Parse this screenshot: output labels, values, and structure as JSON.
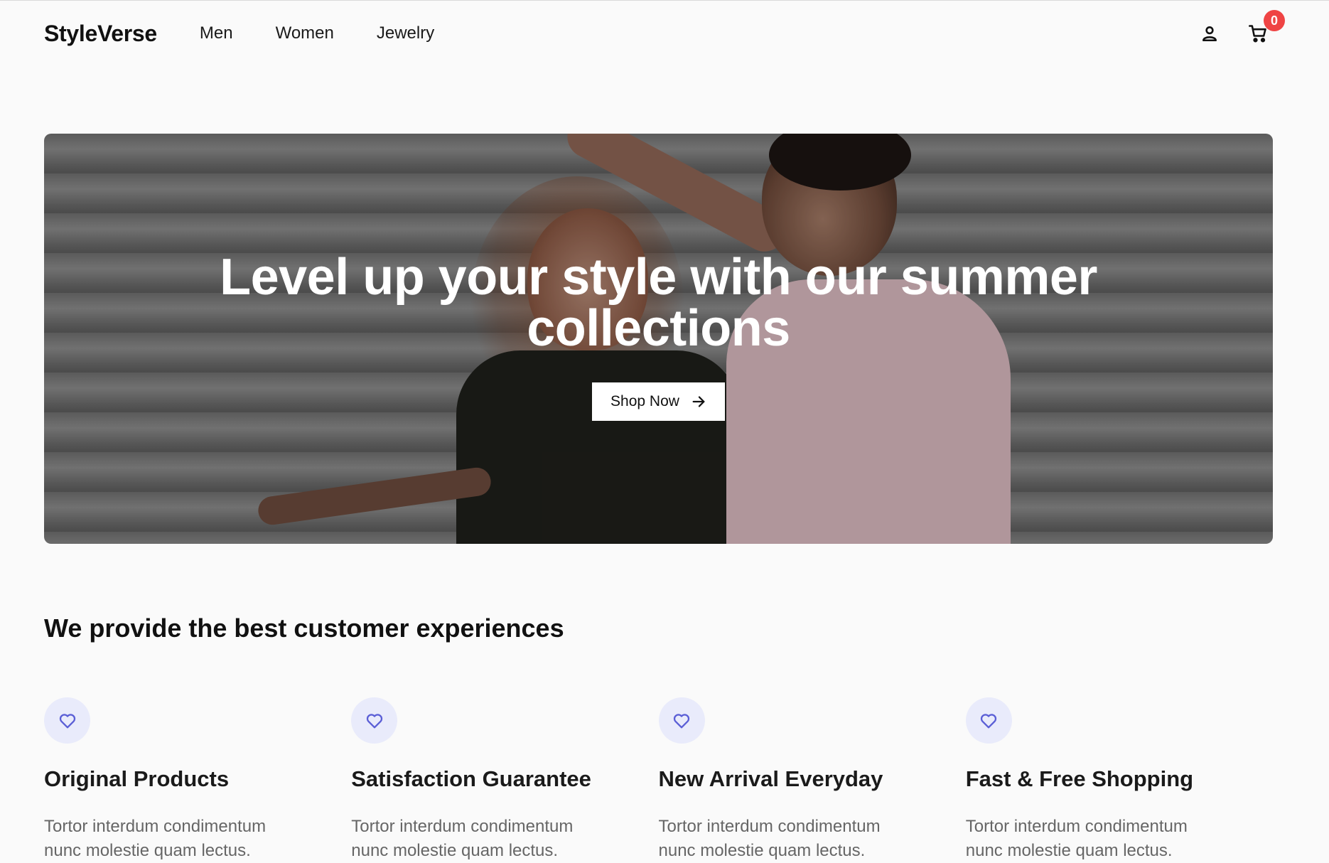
{
  "header": {
    "logo": "StyleVerse",
    "nav": [
      {
        "label": "Men"
      },
      {
        "label": "Women"
      },
      {
        "label": "Jewelry"
      }
    ],
    "cart_count": "0",
    "icons": [
      "user-icon",
      "cart-icon"
    ]
  },
  "hero": {
    "title": "Level up your style with our summer collections",
    "cta_label": "Shop Now",
    "cta_icon": "arrow-right-icon"
  },
  "features_section": {
    "title": "We provide the best customer experiences",
    "items": [
      {
        "icon": "heart-icon",
        "title": "Original Products",
        "desc": "Tortor interdum condimentum nunc molestie quam lectus."
      },
      {
        "icon": "heart-icon",
        "title": "Satisfaction Guarantee",
        "desc": "Tortor interdum condimentum nunc molestie quam lectus."
      },
      {
        "icon": "heart-icon",
        "title": "New Arrival Everyday",
        "desc": "Tortor interdum condimentum nunc molestie quam lectus."
      },
      {
        "icon": "heart-icon",
        "title": "Fast & Free Shopping",
        "desc": "Tortor interdum condimentum nunc molestie quam lectus."
      }
    ]
  },
  "colors": {
    "accent": "#5b5fd6",
    "badge": "#ef4444",
    "icon_bg": "#e9ebfb"
  }
}
